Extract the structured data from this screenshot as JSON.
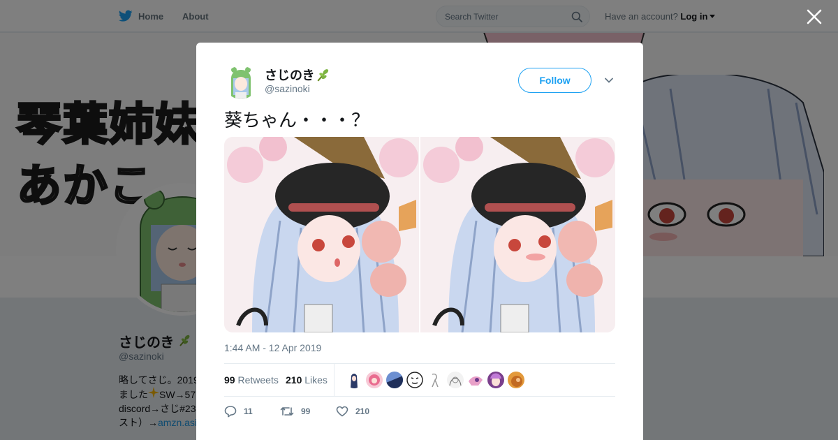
{
  "nav": {
    "home_label": "Home",
    "about_label": "About",
    "search_placeholder": "Search Twitter",
    "account_prompt": "Have an account?",
    "login_label": "Log in"
  },
  "banner": {
    "text_line1": "琴葉姉妹",
    "text_line2": "あかこ"
  },
  "profile": {
    "name": "さじのき",
    "handle": "@sazinoki",
    "bio_line1": "略してさじ。2019",
    "bio_line2": "ました",
    "bio_line2_suffix": "SW→57",
    "bio_line3": "discord→さじ#23",
    "bio_line4": "スト）→",
    "bio_link": "amzn.asi"
  },
  "tweet": {
    "author_name": "さじのき",
    "author_handle": "@sazinoki",
    "follow_label": "Follow",
    "text": "葵ちゃん・・・？",
    "timestamp": "1:44 AM - 12 Apr 2019",
    "retweets_count": "99",
    "retweets_label": "Retweets",
    "likes_count": "210",
    "likes_label": "Likes",
    "reply_count": "11",
    "retweet_action_count": "99",
    "like_action_count": "210"
  },
  "icons": {
    "twitter_bird": "twitter-bird-icon",
    "search": "search-icon",
    "close": "close-icon",
    "chevron": "chevron-down-icon",
    "reply": "reply-icon",
    "retweet": "retweet-icon",
    "like": "heart-icon",
    "sprout": "sprout-emoji-icon",
    "sparkle": "sparkle-emoji-icon"
  },
  "colors": {
    "accent": "#1da1f2",
    "text_primary": "#14171a",
    "text_secondary": "#657786"
  }
}
